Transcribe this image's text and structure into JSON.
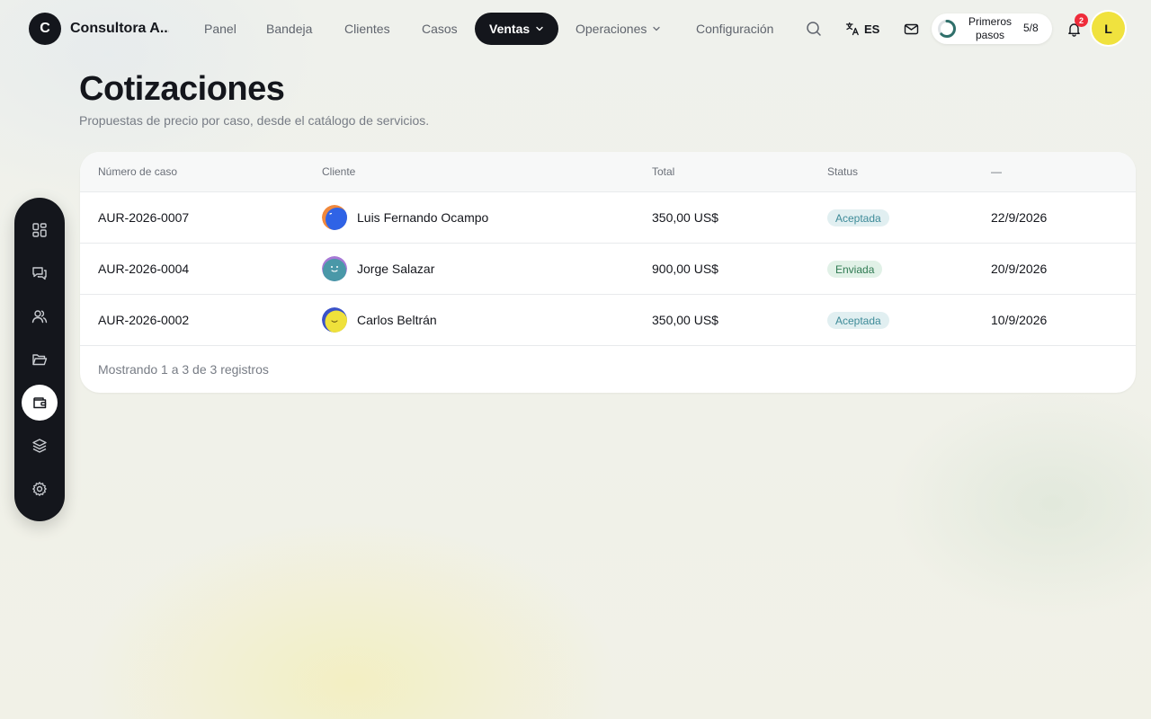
{
  "brand": {
    "logo_letter": "C",
    "name": "Consultora A..."
  },
  "nav": {
    "panel": "Panel",
    "inbox": "Bandeja",
    "clients": "Clientes",
    "cases": "Casos",
    "sales": "Ventas",
    "operations": "Operaciones",
    "settings": "Configuración"
  },
  "topbar": {
    "language": "ES",
    "onboarding": {
      "label": "Primeros pasos",
      "count": "5/8",
      "completed": 5,
      "total": 8
    },
    "notifications_count": "2",
    "user_initial": "L"
  },
  "sidebar": {
    "items": [
      {
        "icon": "grid-icon",
        "active": false
      },
      {
        "icon": "chat-icon",
        "active": false
      },
      {
        "icon": "users-icon",
        "active": false
      },
      {
        "icon": "folder-icon",
        "active": false
      },
      {
        "icon": "wallet-icon",
        "active": true
      },
      {
        "icon": "layers-icon",
        "active": false
      },
      {
        "icon": "gear-icon",
        "active": false
      }
    ]
  },
  "page": {
    "title": "Cotizaciones",
    "subtitle": "Propuestas de precio por caso, desde el catálogo de servicios."
  },
  "table": {
    "columns": {
      "case_number": "Número de caso",
      "client": "Cliente",
      "total": "Total",
      "status": "Status",
      "date": "—"
    },
    "rows": [
      {
        "case": "AUR-2026-0007",
        "client": "Luis Fernando Ocampo",
        "total": "350,00 US$",
        "status": "Aceptada",
        "date": "22/9/2026"
      },
      {
        "case": "AUR-2026-0004",
        "client": "Jorge Salazar",
        "total": "900,00 US$",
        "status": "Enviada",
        "date": "20/9/2026"
      },
      {
        "case": "AUR-2026-0002",
        "client": "Carlos Beltrán",
        "total": "350,00 US$",
        "status": "Aceptada",
        "date": "10/9/2026"
      }
    ],
    "footer": "Mostrando 1 a 3 de 3 registros"
  },
  "colors": {
    "primary_dark": "#14161c",
    "accent_yellow": "#f0e23e",
    "status_accepted": "#3d8a98",
    "status_sent": "#2f7a52",
    "notification_red": "#ef2c3a"
  }
}
